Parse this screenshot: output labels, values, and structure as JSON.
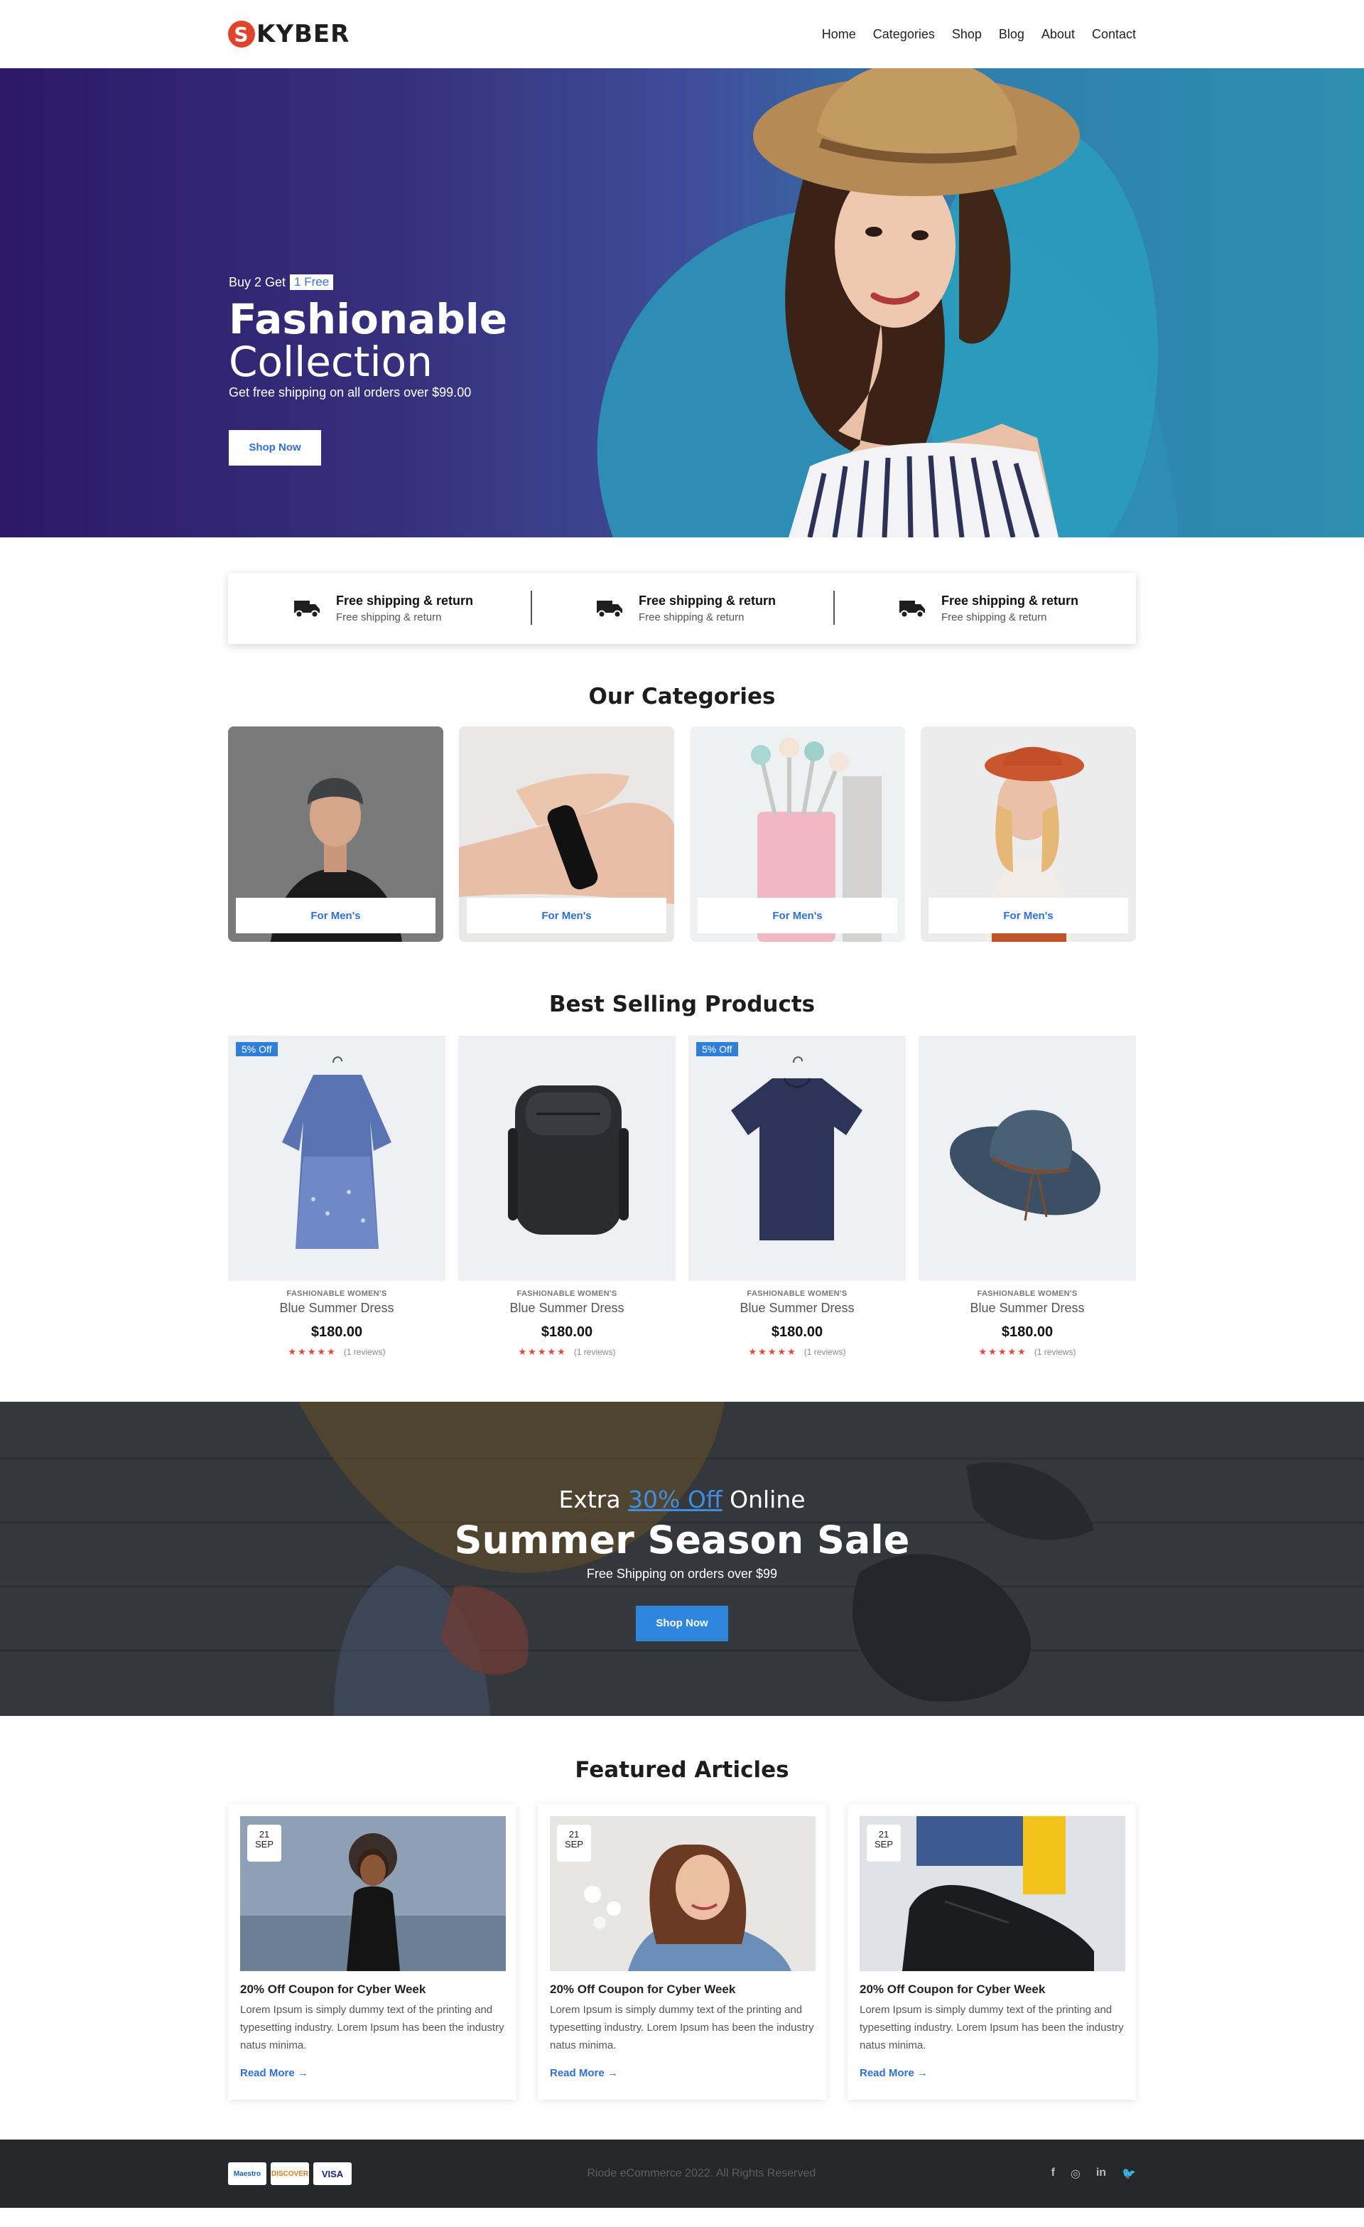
{
  "nav": {
    "logo_letter": "S",
    "logo_text": "KYBER",
    "items": [
      "Home",
      "Categories",
      "Shop",
      "Blog",
      "About",
      "Contact"
    ]
  },
  "hero": {
    "promo_prefix": "Buy 2 Get",
    "promo_badge": "1 Free",
    "title_line1": "Fashionable",
    "title_line2": "Collection",
    "subtitle": "Get free shipping on all orders over $99.00",
    "cta": "Shop Now"
  },
  "features": [
    {
      "title": "Free shipping & return",
      "subtitle": "Free shipping & return",
      "icon": "truck-icon"
    },
    {
      "title": "Free shipping & return",
      "subtitle": "Free shipping & return",
      "icon": "truck-icon"
    },
    {
      "title": "Free shipping & return",
      "subtitle": "Free shipping & return",
      "icon": "truck-icon"
    }
  ],
  "categories": {
    "title": "Our Categories",
    "items": [
      {
        "label": "For Men's"
      },
      {
        "label": "For Men's"
      },
      {
        "label": "For Men's"
      },
      {
        "label": "For Men's"
      }
    ]
  },
  "products": {
    "title": "Best Selling Products",
    "items": [
      {
        "badge": "5% Off",
        "category": "FASHIONABLE WOMEN'S",
        "name": "Blue Summer Dress",
        "price": "$180.00",
        "reviews": "(1 reviews)",
        "rating": 5
      },
      {
        "badge": "",
        "category": "FASHIONABLE WOMEN'S",
        "name": "Blue Summer Dress",
        "price": "$180.00",
        "reviews": "(1 reviews)",
        "rating": 5
      },
      {
        "badge": "5% Off",
        "category": "FASHIONABLE WOMEN'S",
        "name": "Blue Summer Dress",
        "price": "$180.00",
        "reviews": "(1 reviews)",
        "rating": 5
      },
      {
        "badge": "",
        "category": "FASHIONABLE WOMEN'S",
        "name": "Blue Summer Dress",
        "price": "$180.00",
        "reviews": "(1 reviews)",
        "rating": 5
      }
    ]
  },
  "sale": {
    "line1_prefix": "Extra",
    "line1_highlight": "30% Off",
    "line1_suffix": "Online",
    "title": "Summer Season Sale",
    "subtitle": "Free Shipping on orders over $99",
    "cta": "Shop Now"
  },
  "articles": {
    "title": "Featured Articles",
    "items": [
      {
        "day": "21",
        "month": "SEP",
        "title": "20% Off Coupon for Cyber Week",
        "body": "Lorem Ipsum is simply dummy text of the printing and typesetting industry. Lorem Ipsum has been the industry natus minima.",
        "link": "Read More →"
      },
      {
        "day": "21",
        "month": "SEP",
        "title": "20% Off Coupon for Cyber Week",
        "body": "Lorem Ipsum is simply dummy text of the printing and typesetting industry. Lorem Ipsum has been the industry natus minima.",
        "link": "Read More →"
      },
      {
        "day": "21",
        "month": "SEP",
        "title": "20% Off Coupon for Cyber Week",
        "body": "Lorem Ipsum is simply dummy text of the printing and typesetting industry. Lorem Ipsum has been the industry natus minima.",
        "link": "Read More →"
      }
    ]
  },
  "footer": {
    "payments": [
      "Maestro",
      "DISCOVER",
      "VISA"
    ],
    "copyright": "Riode eCommerce 2022. All Rights Reserved",
    "social": [
      "facebook-icon",
      "instagram-icon",
      "linkedin-icon",
      "twitter-icon"
    ],
    "social_glyphs": [
      "f",
      "◎",
      "in",
      "🐦"
    ]
  },
  "colors": {
    "accent": "#2f7fd8",
    "logo_red": "#e0432b",
    "star": "#e04a3a"
  }
}
